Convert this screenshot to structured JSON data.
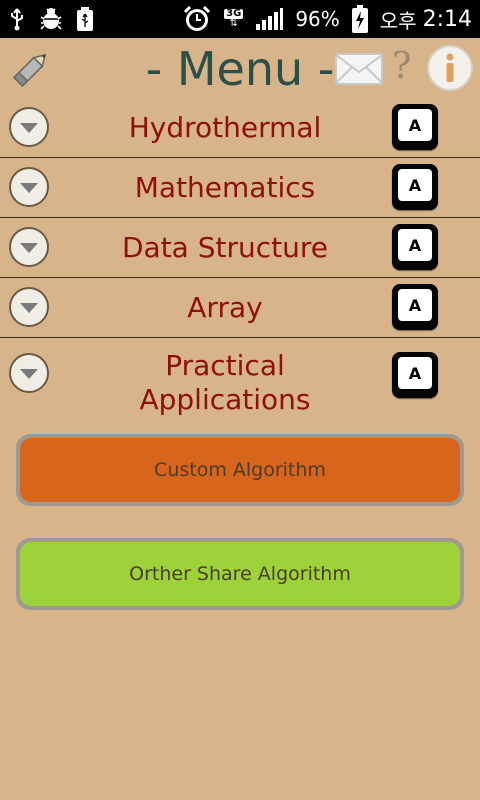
{
  "status_bar": {
    "network_label": "3G",
    "battery": "96%",
    "ampm": "오후",
    "time": "2:14",
    "icons": [
      "usb-icon",
      "debug-bug-icon",
      "usb-storage-icon",
      "alarm-icon",
      "signal-icon",
      "battery-charging-icon"
    ]
  },
  "header": {
    "title": "- Menu -",
    "help_glyph": "?",
    "icons": [
      "pencil-icon",
      "mail-icon",
      "help-icon",
      "info-icon"
    ]
  },
  "categories": [
    {
      "label": "Hydrothermal",
      "key": "A"
    },
    {
      "label": "Mathematics",
      "key": "A"
    },
    {
      "label": "Data Structure",
      "key": "A"
    },
    {
      "label": "Array",
      "key": "A"
    },
    {
      "label": "Practical\nApplications",
      "key": "A"
    }
  ],
  "buttons": {
    "custom": {
      "label": "Custom Algorithm",
      "color": "#d8651c"
    },
    "other": {
      "label": "Orther Share Algorithm",
      "color": "#9ed23a"
    }
  },
  "colors": {
    "background": "#d8b48a",
    "category_text": "#8f0e0e",
    "title_text": "#2c4f48"
  }
}
